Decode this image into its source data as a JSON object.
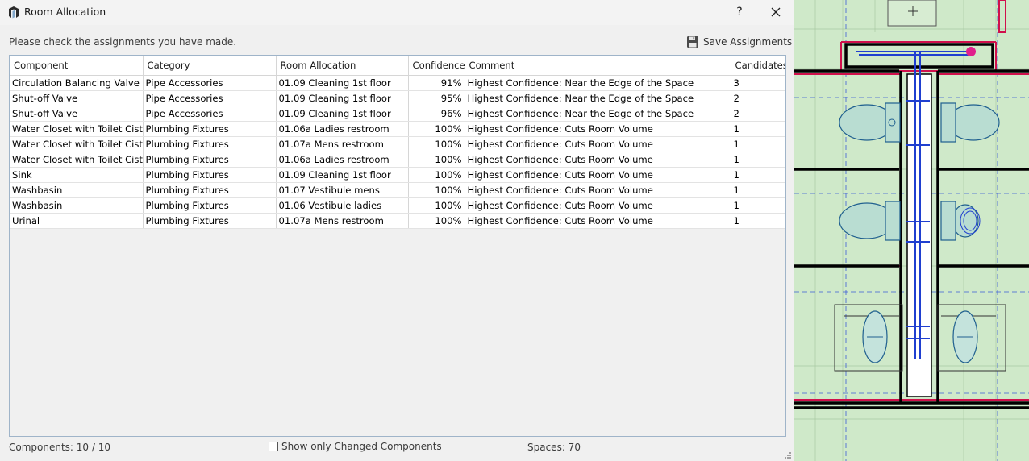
{
  "window": {
    "title": "Room Allocation",
    "help_label": "?"
  },
  "instruction": "Please check the assignments you have made.",
  "toolbar": {
    "save_label": "Save Assignments"
  },
  "table": {
    "columns": [
      "Component",
      "Category",
      "Room Allocation",
      "Confidence",
      "Comment",
      "Candidates"
    ],
    "rows": [
      [
        "Circulation Balancing Valve",
        "Pipe Accessories",
        "01.09 Cleaning 1st floor",
        "91%",
        "Highest Confidence: Near the Edge of the Space",
        "3"
      ],
      [
        "Shut-off Valve",
        "Pipe Accessories",
        "01.09 Cleaning 1st floor",
        "95%",
        "Highest Confidence: Near the Edge of the Space",
        "2"
      ],
      [
        "Shut-off Valve",
        "Pipe Accessories",
        "01.09 Cleaning 1st floor",
        "96%",
        "Highest Confidence: Near the Edge of the Space",
        "2"
      ],
      [
        "Water Closet with Toilet Ciste",
        "Plumbing Fixtures",
        "01.06a Ladies restroom",
        "100%",
        "Highest Confidence: Cuts Room Volume",
        "1"
      ],
      [
        "Water Closet with Toilet Ciste",
        "Plumbing Fixtures",
        "01.07a Mens restroom",
        "100%",
        "Highest Confidence: Cuts Room Volume",
        "1"
      ],
      [
        "Water Closet with Toilet Ciste",
        "Plumbing Fixtures",
        "01.06a Ladies restroom",
        "100%",
        "Highest Confidence: Cuts Room Volume",
        "1"
      ],
      [
        "Sink",
        "Plumbing Fixtures",
        "01.09 Cleaning 1st floor",
        "100%",
        "Highest Confidence: Cuts Room Volume",
        "1"
      ],
      [
        "Washbasin",
        "Plumbing Fixtures",
        "01.07 Vestibule mens",
        "100%",
        "Highest Confidence: Cuts Room Volume",
        "1"
      ],
      [
        "Washbasin",
        "Plumbing Fixtures",
        "01.06 Vestibule ladies",
        "100%",
        "Highest Confidence: Cuts Room Volume",
        "1"
      ],
      [
        "Urinal",
        "Plumbing Fixtures",
        "01.07a Mens restroom",
        "100%",
        "Highest Confidence: Cuts Room Volume",
        "1"
      ]
    ]
  },
  "status": {
    "components": "Components: 10 / 10",
    "filter_label": "Show only Changed Components",
    "filter_checked": false,
    "spaces": "Spaces: 70"
  },
  "icons": {
    "app": "app-logo-icon",
    "close": "close-icon",
    "save": "floppy-disk-icon",
    "resize": "resize-grip-icon"
  },
  "colors": {
    "dialog_bg": "#f0f0f0",
    "grid_border": "#9fb4c9",
    "cad_bg": "#cfe9c9",
    "cad_wall_red": "#d0104c",
    "cad_pipe_blue": "#1f3fd0",
    "cad_marker": "#e0208c"
  }
}
